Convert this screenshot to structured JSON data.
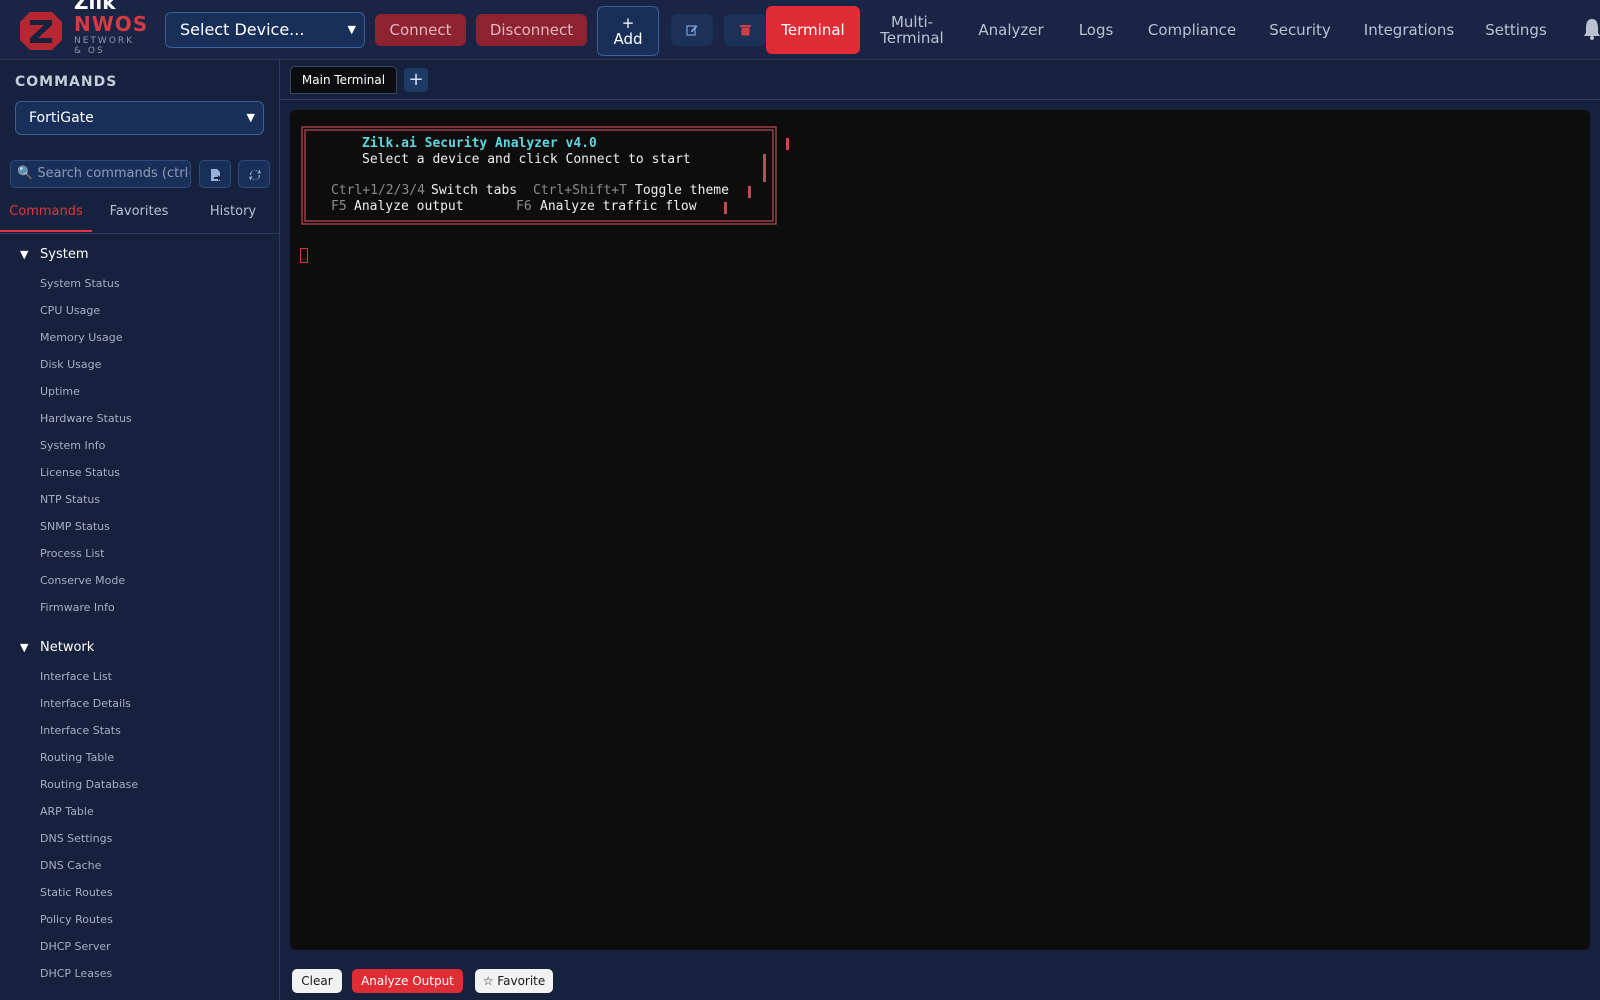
{
  "brand": {
    "name_top": "Zilk",
    "name_main": "NWOS",
    "subtitle": "NETWORK & OS",
    "accent_color": "#e02c34"
  },
  "toolbar": {
    "device_select": "Select Device...",
    "connect_label": "Connect",
    "disconnect_label": "Disconnect",
    "add_icon": "+",
    "add_label": "Add",
    "edit_icon": "edit-icon",
    "delete_icon": "trash-icon"
  },
  "nav": {
    "terminal": "Terminal",
    "multi_terminal_line1": "Multi-",
    "multi_terminal_line2": "Terminal",
    "analyzer": "Analyzer",
    "logs": "Logs",
    "compliance": "Compliance",
    "security": "Security",
    "integrations": "Integrations",
    "settings": "Settings",
    "notifications_icon": "bell-icon"
  },
  "sidebar": {
    "title": "COMMANDS",
    "vendor_select": "FortiGate",
    "search_placeholder": "🔍 Search commands (ctrl+k)",
    "tabs": {
      "commands": "Commands",
      "favorites": "Favorites",
      "history": "History"
    },
    "categories": [
      {
        "name": "System",
        "items": [
          "System Status",
          "CPU Usage",
          "Memory Usage",
          "Disk Usage",
          "Uptime",
          "Hardware Status",
          "System Info",
          "License Status",
          "NTP Status",
          "SNMP Status",
          "Process List",
          "Conserve Mode",
          "Firmware Info"
        ]
      },
      {
        "name": "Network",
        "items": [
          "Interface List",
          "Interface Details",
          "Interface Stats",
          "Routing Table",
          "Routing Database",
          "ARP Table",
          "DNS Settings",
          "DNS Cache",
          "Static Routes",
          "Policy Routes",
          "DHCP Server",
          "DHCP Leases"
        ]
      }
    ]
  },
  "terminal": {
    "tab_label": "Main Terminal",
    "add_tab": "+",
    "banner_title": "Zilk.ai Security Analyzer v4.0",
    "banner_subtitle": "Select a device and click Connect to start",
    "shortcut1_key": "Ctrl+1/2/3/4",
    "shortcut1_label": "Switch tabs",
    "shortcut2_key": "Ctrl+Shift+T",
    "shortcut2_label": "Toggle theme",
    "shortcut3_key": "F5",
    "shortcut3_label": "Analyze output",
    "shortcut4_key": "F6",
    "shortcut4_label": "Analyze traffic flow"
  },
  "bottom": {
    "clear_label": "Clear",
    "analyze_label": "Analyze Output",
    "favorite_label": "☆ Favorite"
  }
}
